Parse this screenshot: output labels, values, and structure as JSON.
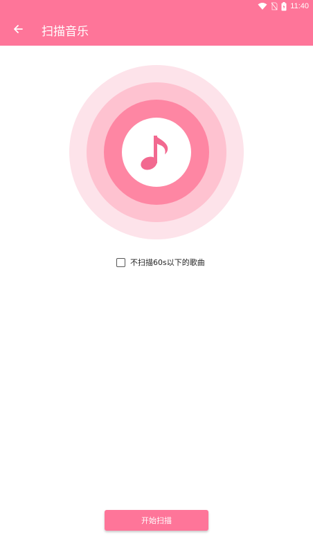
{
  "status_bar": {
    "time": "11:40",
    "icons": [
      "wifi-icon",
      "no-sim-icon",
      "battery-charging-icon"
    ]
  },
  "header": {
    "title": "扫描音乐",
    "back_icon": "arrow-left-icon"
  },
  "scan_graphic": {
    "icon": "music-note-icon",
    "colors": [
      "#fde3ea",
      "#fec2d0",
      "#fe86a3",
      "#ffffff"
    ]
  },
  "options": {
    "skip_short_label": "不扫描60s以下的歌曲",
    "skip_short_checked": false
  },
  "footer": {
    "start_label": "开始扫描"
  },
  "colors": {
    "primary": "#fe7599",
    "accent": "#fe86a3"
  }
}
